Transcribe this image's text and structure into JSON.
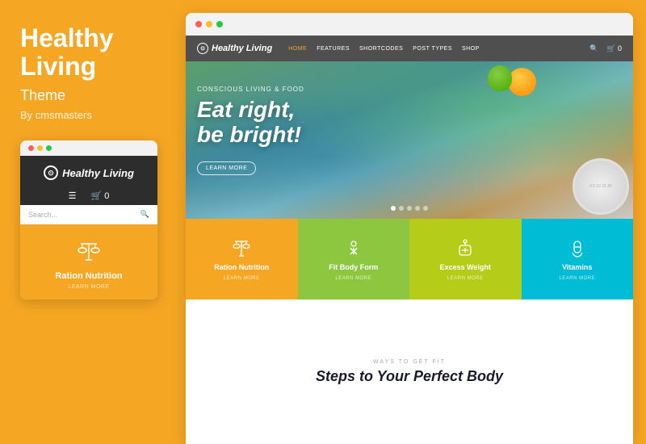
{
  "left": {
    "title": "Healthy\nLiving",
    "subtitle": "Theme",
    "byline": "By cmsmasters",
    "logo": "Healthy Living",
    "logo_symbol": "⊙",
    "search_placeholder": "Search...",
    "feature": {
      "label": "Ration Nutrition",
      "learn": "LEARN MORE"
    }
  },
  "browser": {
    "nav": {
      "logo": "Healthy Living",
      "items": [
        "HOME",
        "FEATURES",
        "SHORTCODES",
        "POST TYPES",
        "SHOP"
      ]
    },
    "hero": {
      "subtitle": "Conscious Living & Food",
      "title_line1": "Eat right,",
      "title_line2": "be bright!",
      "btn_label": "LEARN MORE"
    },
    "features": [
      {
        "id": "ration",
        "label": "Ration Nutrition",
        "learn": "LEARN MORE",
        "color": "fb-orange"
      },
      {
        "id": "fit",
        "label": "Fit Body Form",
        "learn": "LEARN MORE",
        "color": "fb-green"
      },
      {
        "id": "excess",
        "label": "Excess Weight",
        "learn": "LEARN MORE",
        "color": "fb-lime"
      },
      {
        "id": "vitamins",
        "label": "Vitamins",
        "learn": "LEARN MORE",
        "color": "fb-teal"
      }
    ],
    "bottom": {
      "ways_label": "WAYS TO GET FIT",
      "steps_title": "Steps to Your Perfect Body"
    }
  }
}
